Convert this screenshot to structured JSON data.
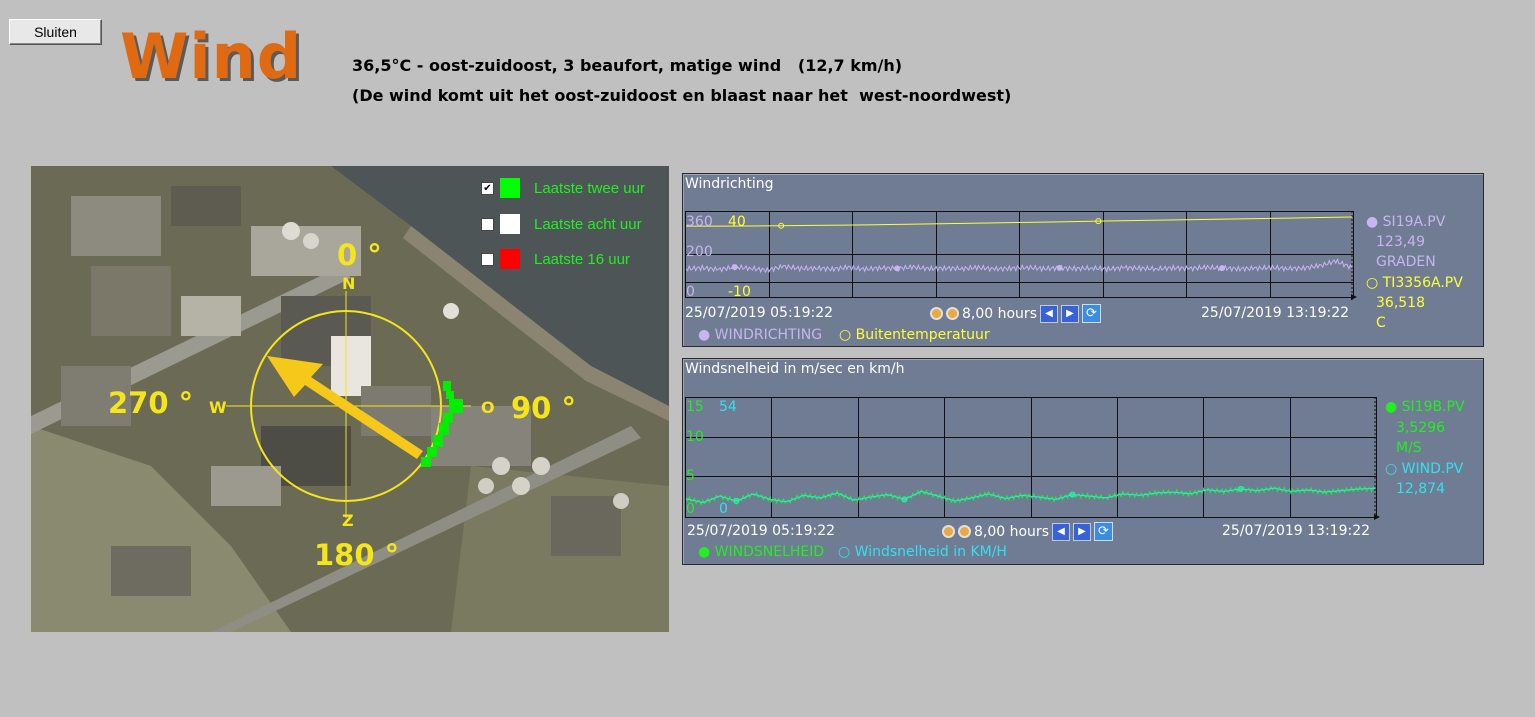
{
  "window": {
    "close_label": "Sluiten",
    "title": "Wind"
  },
  "status": {
    "line1": "36,5°C - oost-zuidoost, 3 beaufort, matige wind   (12,7 km/h)",
    "line2": "(De wind komt uit het oost-zuidoost en blaast naar het  west-noordwest)"
  },
  "map_legend": [
    {
      "label": "Laatste twee uur",
      "checked": true,
      "color": "#00ff00"
    },
    {
      "label": "Laatste acht uur",
      "checked": false,
      "color": "#ffffff"
    },
    {
      "label": "Laatste 16 uur",
      "checked": false,
      "color": "#ff0000"
    }
  ],
  "compass": {
    "north_deg": "0 °",
    "north_letter": "N",
    "east_deg": "90 °",
    "east_letter": "O",
    "south_deg": "180 °",
    "south_letter": "Z",
    "west_deg": "270 °",
    "west_letter": "W",
    "arrow_color": "#f5c81a",
    "ring_color": "#f5e61a",
    "wind_from_direction": "oost-zuidoost",
    "wind_to_direction": "west-noordwest"
  },
  "panel_direction": {
    "title": "Windrichting",
    "y_ticks_left": [
      "360",
      "200",
      "0"
    ],
    "y_ticks_right": [
      "40",
      "-10"
    ],
    "start_time": "25/07/2019 05:19:22",
    "end_time": "25/07/2019 13:19:22",
    "span": "8,00 hours",
    "side_values": [
      {
        "marker": "●",
        "tag": "SI19A.PV",
        "value": "123,49",
        "unit": "GRADEN",
        "color": "#c8b4f0"
      },
      {
        "marker": "○",
        "tag": "TI3356A.PV",
        "value": "36,518",
        "unit": "C",
        "color": "#ffff33"
      }
    ],
    "legend": [
      {
        "marker": "●",
        "label": "WINDRICHTING",
        "color": "#c8b4f0"
      },
      {
        "marker": "○",
        "label": "Buitentemperatuur",
        "color": "#ffff33"
      }
    ]
  },
  "panel_speed": {
    "title": "Windsnelheid in m/sec en km/h",
    "y_ticks_left": [
      "15",
      "10",
      "5",
      "0"
    ],
    "y_ticks_right": [
      "54",
      "0"
    ],
    "start_time": "25/07/2019 05:19:22",
    "end_time": "25/07/2019 13:19:22",
    "span": "8,00 hours",
    "side_values": [
      {
        "marker": "●",
        "tag": "SI19B.PV",
        "value": "3,5296",
        "unit": "M/S",
        "color": "#22ee22"
      },
      {
        "marker": "○",
        "tag": "WIND.PV",
        "value": "12,874",
        "unit": "",
        "color": "#33e0f0"
      }
    ],
    "legend": [
      {
        "marker": "●",
        "label": "WINDSNELHEID",
        "color": "#22ee22"
      },
      {
        "marker": "○",
        "label": "Windsnelheid in KM/H",
        "color": "#33e0f0"
      }
    ]
  },
  "chart_data": [
    {
      "type": "line",
      "title": "Windrichting",
      "x_range": [
        "25/07/2019 05:19:22",
        "25/07/2019 13:19:22"
      ],
      "series": [
        {
          "name": "WINDRICHTING",
          "color": "#c8b4f0",
          "ylim": [
            0,
            360
          ],
          "values": [
            118,
            122,
            115,
            125,
            120,
            112,
            128,
            119,
            121,
            117,
            124,
            116,
            122,
            120,
            125,
            118,
            121,
            119,
            123,
            117,
            120,
            124,
            118,
            122,
            119,
            121,
            117,
            123,
            120,
            118,
            122,
            119,
            124,
            121,
            118,
            120,
            123,
            119,
            121,
            130,
            150,
            123
          ]
        },
        {
          "name": "Buitentemperatuur",
          "color": "#ffff33",
          "ylim": [
            -10,
            40
          ],
          "values": [
            31.2,
            31.2,
            31.3,
            31.4,
            31.6,
            31.8,
            32.0,
            32.3,
            32.6,
            32.9,
            33.2,
            33.5,
            33.8,
            34.1,
            34.4,
            34.7,
            35.0,
            35.3,
            35.6,
            35.9,
            36.2,
            36.5
          ]
        }
      ],
      "grid": true
    },
    {
      "type": "line",
      "title": "Windsnelheid in m/sec en km/h",
      "x_range": [
        "25/07/2019 05:19:22",
        "25/07/2019 13:19:22"
      ],
      "series": [
        {
          "name": "WINDSNELHEID",
          "color": "#22ee22",
          "ylim": [
            0,
            15
          ],
          "values": [
            2.3,
            1.8,
            2.6,
            2.0,
            2.9,
            2.2,
            1.9,
            2.7,
            2.4,
            3.0,
            2.1,
            2.5,
            2.8,
            2.2,
            3.2,
            2.6,
            2.0,
            2.4,
            2.9,
            2.3,
            2.7,
            2.5,
            2.2,
            2.8,
            2.6,
            2.4,
            2.9,
            2.7,
            3.0,
            3.1,
            2.9,
            3.4,
            3.2,
            3.5,
            3.3,
            3.6,
            3.2,
            3.4,
            3.1,
            3.3,
            3.5,
            3.53
          ]
        },
        {
          "name": "Windsnelheid in KM/H",
          "color": "#33e0f0",
          "ylim": [
            0,
            54
          ],
          "values": [
            8.3,
            6.5,
            9.4,
            7.2,
            10.4,
            7.9,
            6.8,
            9.7,
            8.6,
            10.8,
            7.6,
            9.0,
            10.1,
            7.9,
            11.5,
            9.4,
            7.2,
            8.6,
            10.4,
            8.3,
            9.7,
            9.0,
            7.9,
            10.1,
            9.4,
            8.6,
            10.4,
            9.7,
            10.8,
            11.2,
            10.4,
            12.2,
            11.5,
            12.6,
            11.9,
            13.0,
            11.5,
            12.2,
            11.2,
            11.9,
            12.6,
            12.87
          ]
        }
      ],
      "grid": true
    }
  ]
}
